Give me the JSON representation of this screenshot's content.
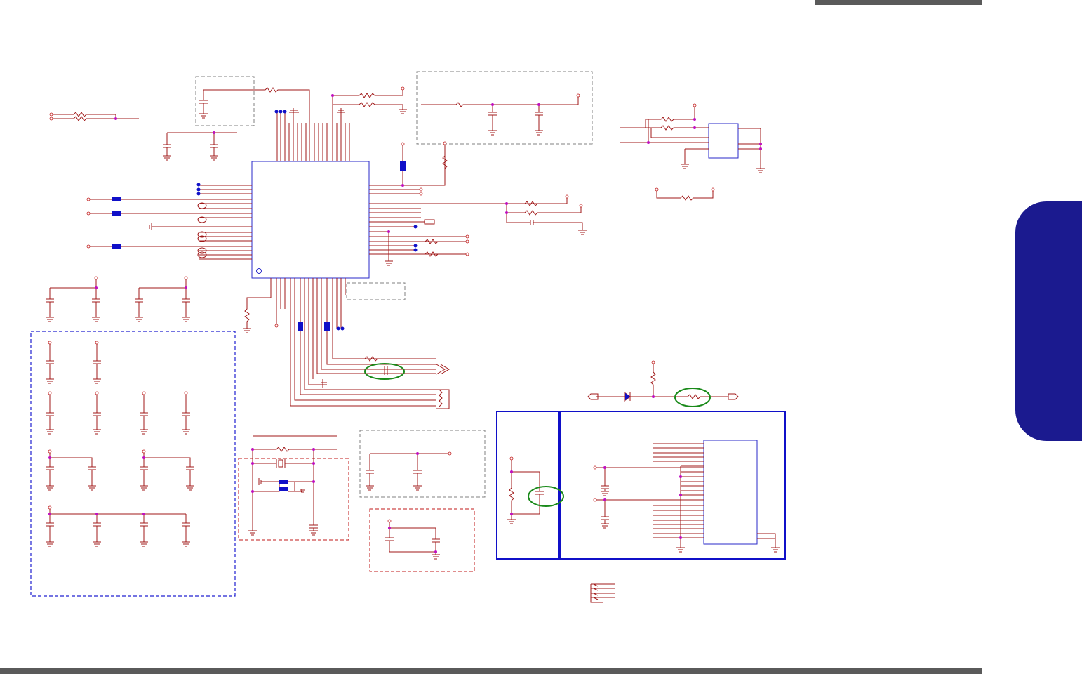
{
  "page": {
    "header_bar_color": "#5a5a5a",
    "footer_bar_color": "#5a5a5a",
    "side_tab_color": "#1b1a8f"
  },
  "schematic": {
    "wire_color": "#a01818",
    "component_color": "#2a2ac8",
    "highlight_ring_color": "#1a8a1a",
    "junction_color": "#c010c0"
  }
}
